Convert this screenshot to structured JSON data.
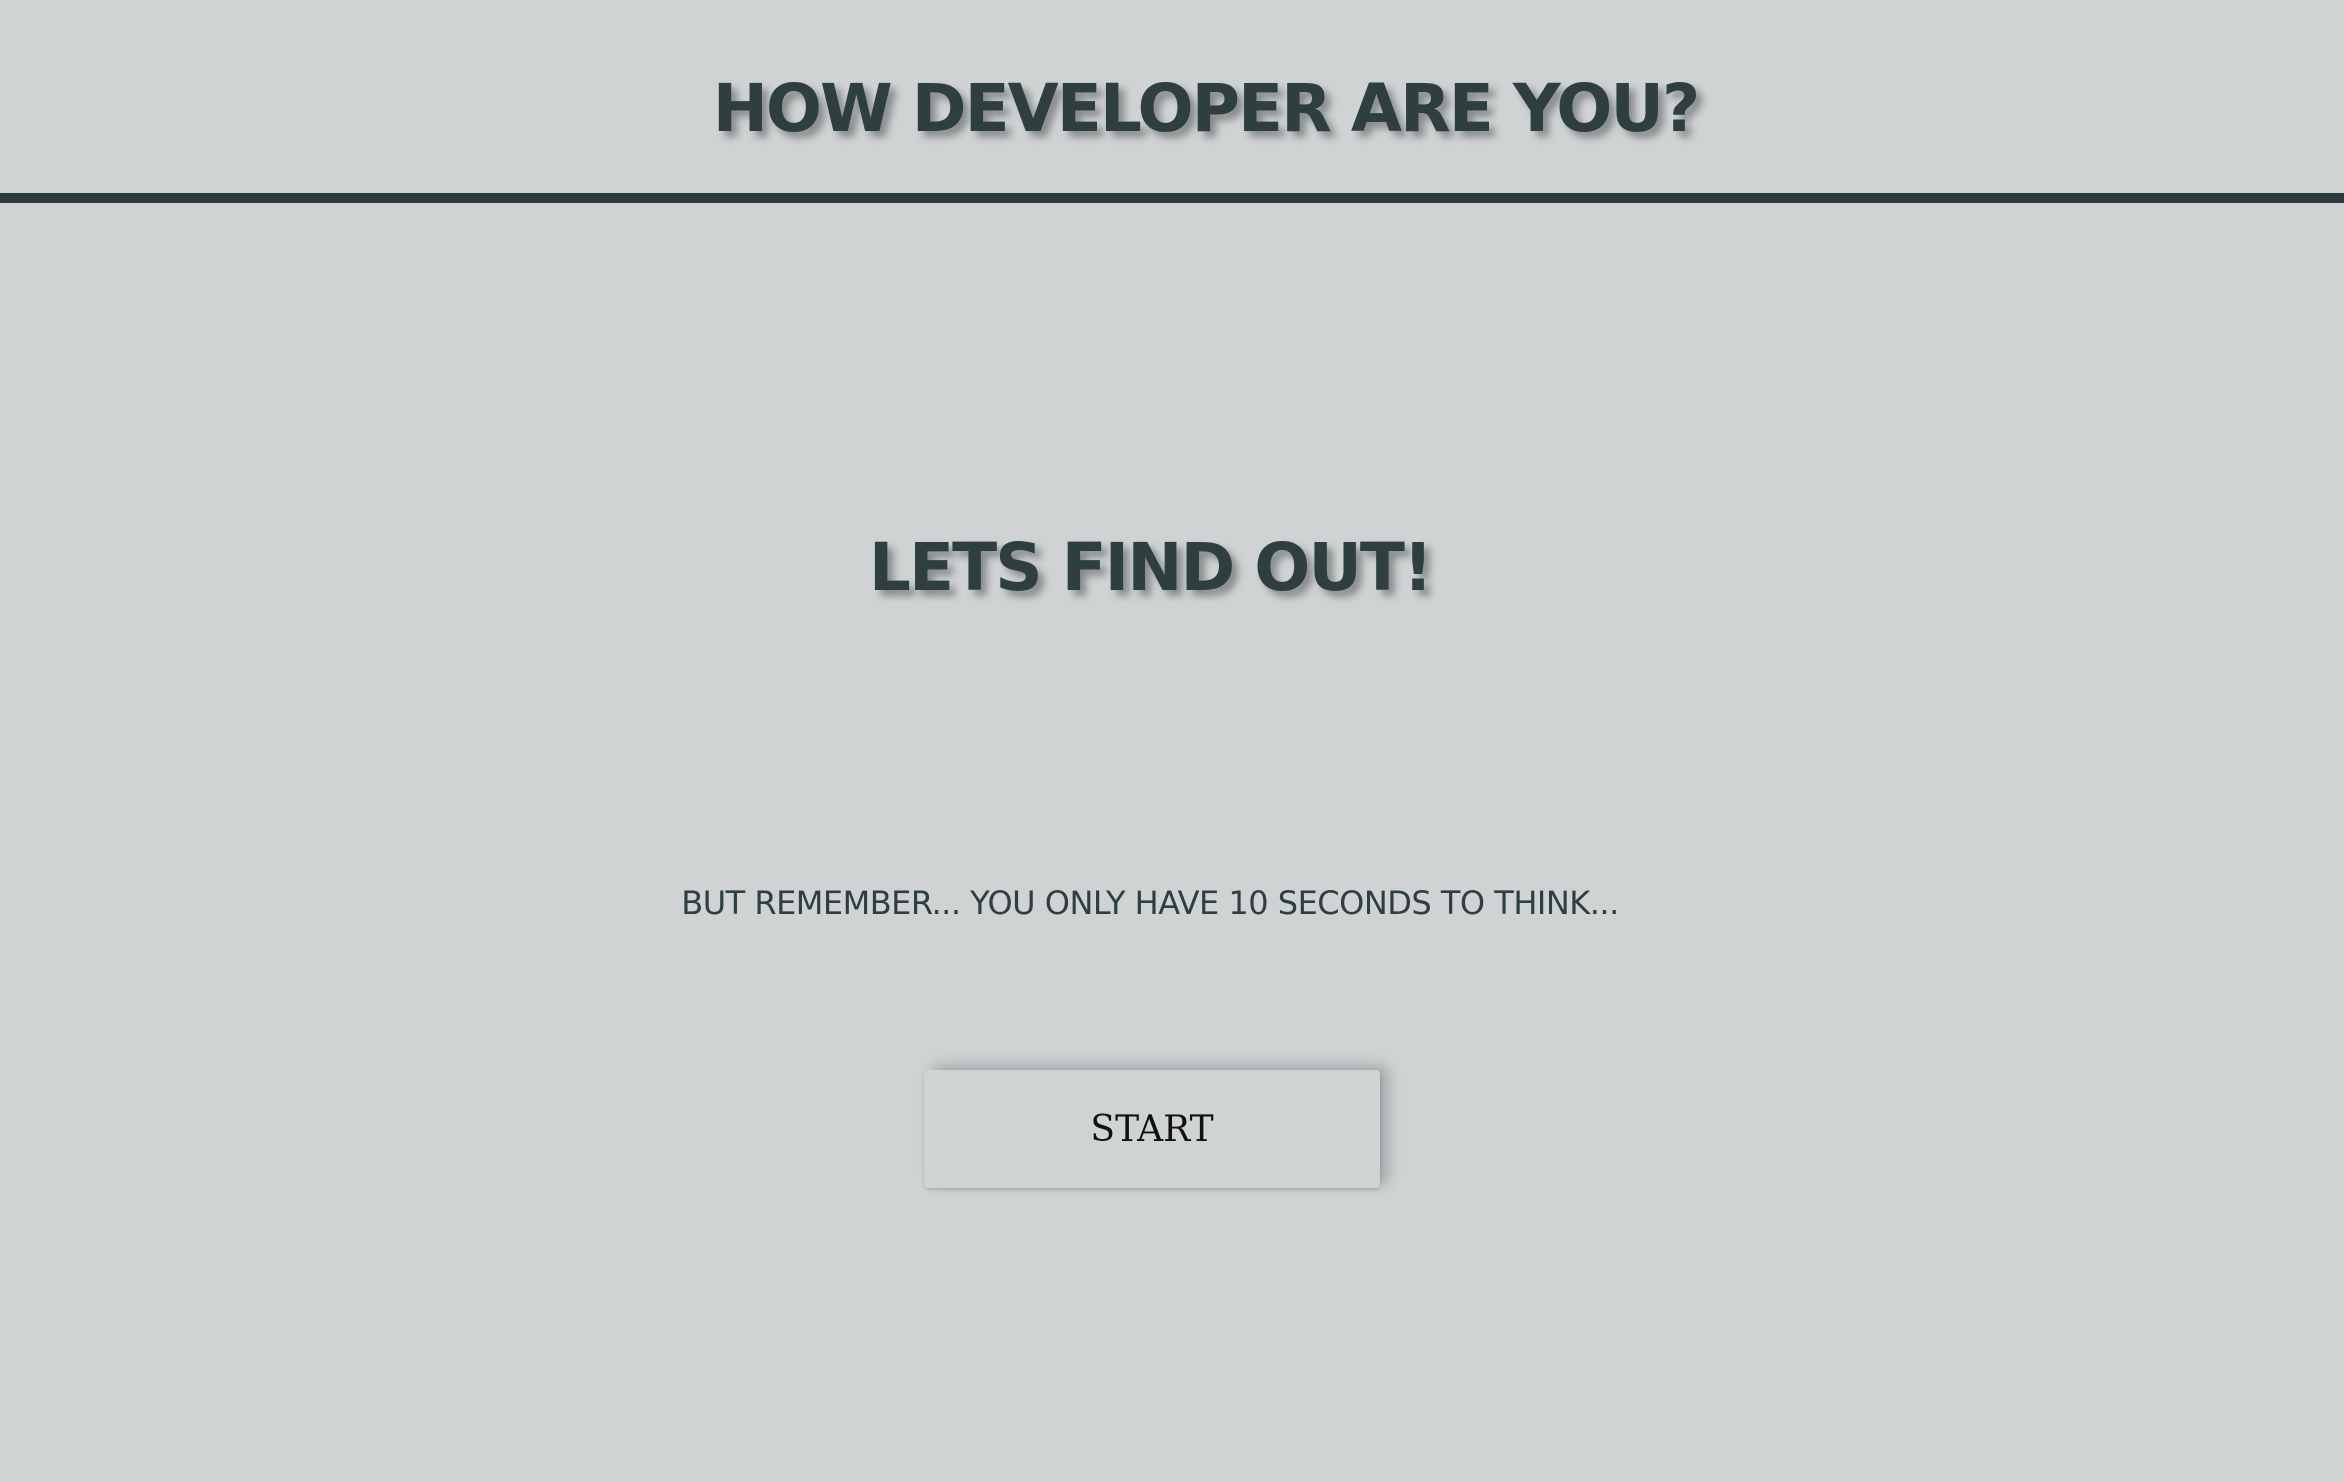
{
  "header": {
    "title": "HOW DEVELOPER ARE YOU?"
  },
  "main": {
    "heading": "LETS FIND OUT!",
    "reminder": "BUT REMEMBER... YOU ONLY HAVE 10 SECONDS TO THINK...",
    "start_label": "START"
  },
  "colors": {
    "background": "#cfd3d4",
    "text": "#2f3f3f",
    "divider": "#2e3b3b"
  }
}
